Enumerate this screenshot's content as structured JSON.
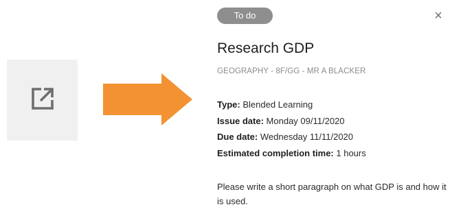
{
  "task": {
    "status": "To do",
    "title": "Research GDP",
    "subtitle": "GEOGRAPHY - 8F/GG - MR A BLACKER",
    "details": [
      {
        "label": "Type:",
        "value": "Blended Learning"
      },
      {
        "label": "Issue date:",
        "value": "Monday 09/11/2020"
      },
      {
        "label": "Due date:",
        "value": "Wednesday 11/11/2020"
      },
      {
        "label": "Estimated completion time:",
        "value": "1 hours"
      }
    ],
    "description": "Please write a short paragraph on what GDP is and how it is used."
  },
  "icons": {
    "open": "open-in-new-icon",
    "arrow": "arrow-right-icon",
    "close": "close-icon"
  },
  "colors": {
    "arrow": "#f39233",
    "status_pill": "#8e8e8e",
    "icon_box": "#f0f0f0",
    "icon_gray": "#6e6e6e"
  }
}
